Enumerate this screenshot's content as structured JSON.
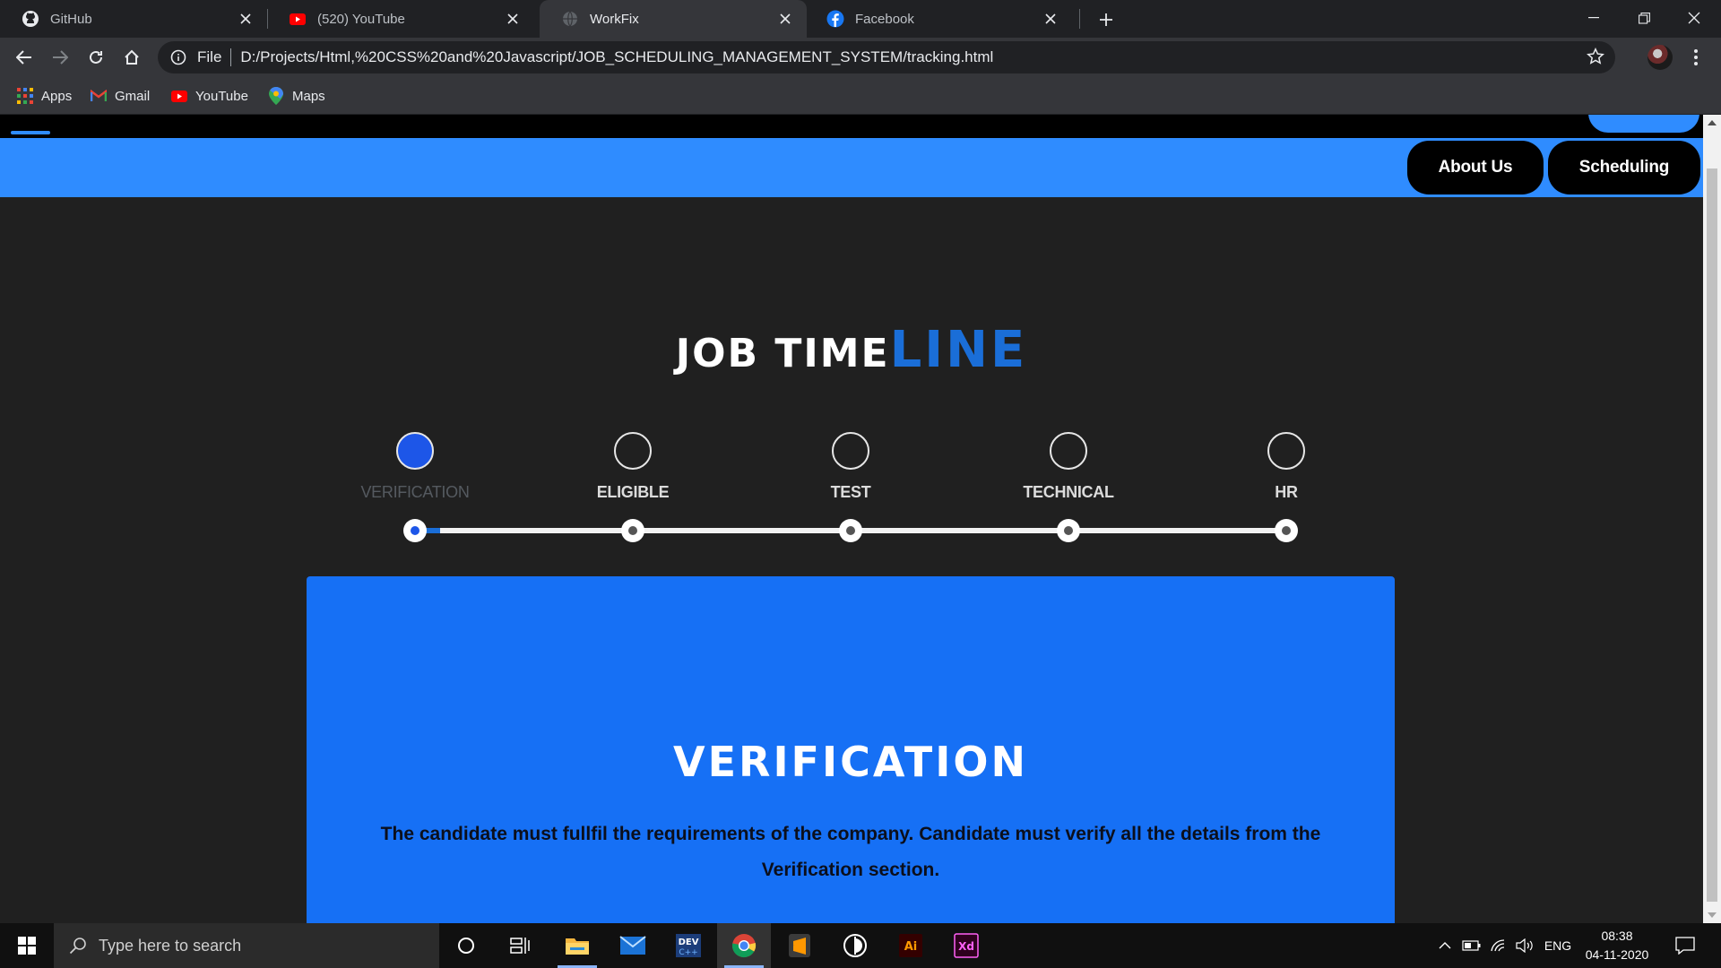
{
  "browser": {
    "tabs": [
      {
        "title": "GitHub",
        "icon": "github-icon"
      },
      {
        "title": "(520) YouTube",
        "icon": "youtube-icon"
      },
      {
        "title": "WorkFix",
        "icon": "globe-icon"
      },
      {
        "title": "Facebook",
        "icon": "facebook-icon"
      }
    ],
    "active_tab": 2,
    "address": {
      "scheme": "File",
      "url": "D:/Projects/Html,%20CSS%20and%20Javascript/JOB_SCHEDULING_MANAGEMENT_SYSTEM/tracking.html"
    },
    "bookmarks": [
      {
        "label": "Apps",
        "icon": "apps-grid-icon"
      },
      {
        "label": "Gmail",
        "icon": "gmail-icon"
      },
      {
        "label": "YouTube",
        "icon": "youtube-icon"
      },
      {
        "label": "Maps",
        "icon": "maps-icon"
      }
    ]
  },
  "page": {
    "nav": {
      "about": "About Us",
      "scheduling": "Scheduling"
    },
    "heading": {
      "part1": "JOB TIME",
      "part2": "LINE"
    },
    "steps": [
      {
        "label": "VERIFICATION"
      },
      {
        "label": "ELIGIBLE"
      },
      {
        "label": "TEST"
      },
      {
        "label": "TECHNICAL"
      },
      {
        "label": "HR"
      }
    ],
    "active_step": 0,
    "progress_fraction": 0.03,
    "card": {
      "title": "VERIFICATION",
      "description": "The candidate must fullfil the requirements of the company. Candidate must verify all the details from the Verification section."
    }
  },
  "taskbar": {
    "search_placeholder": "Type here to search",
    "apps": [
      "cortana-icon",
      "task-view-icon",
      "file-explorer-icon",
      "mail-icon",
      "dev-cpp-icon",
      "chrome-icon",
      "sublime-text-icon",
      "inkscape-icon",
      "illustrator-icon",
      "adobe-xd-icon"
    ],
    "language": "ENG",
    "time": "08:38",
    "date": "04-11-2020"
  },
  "colors": {
    "accent_blue": "#2f8cff",
    "card_blue": "#1670f5",
    "heading_blue": "#1a6ed8",
    "page_bg": "#202020"
  }
}
